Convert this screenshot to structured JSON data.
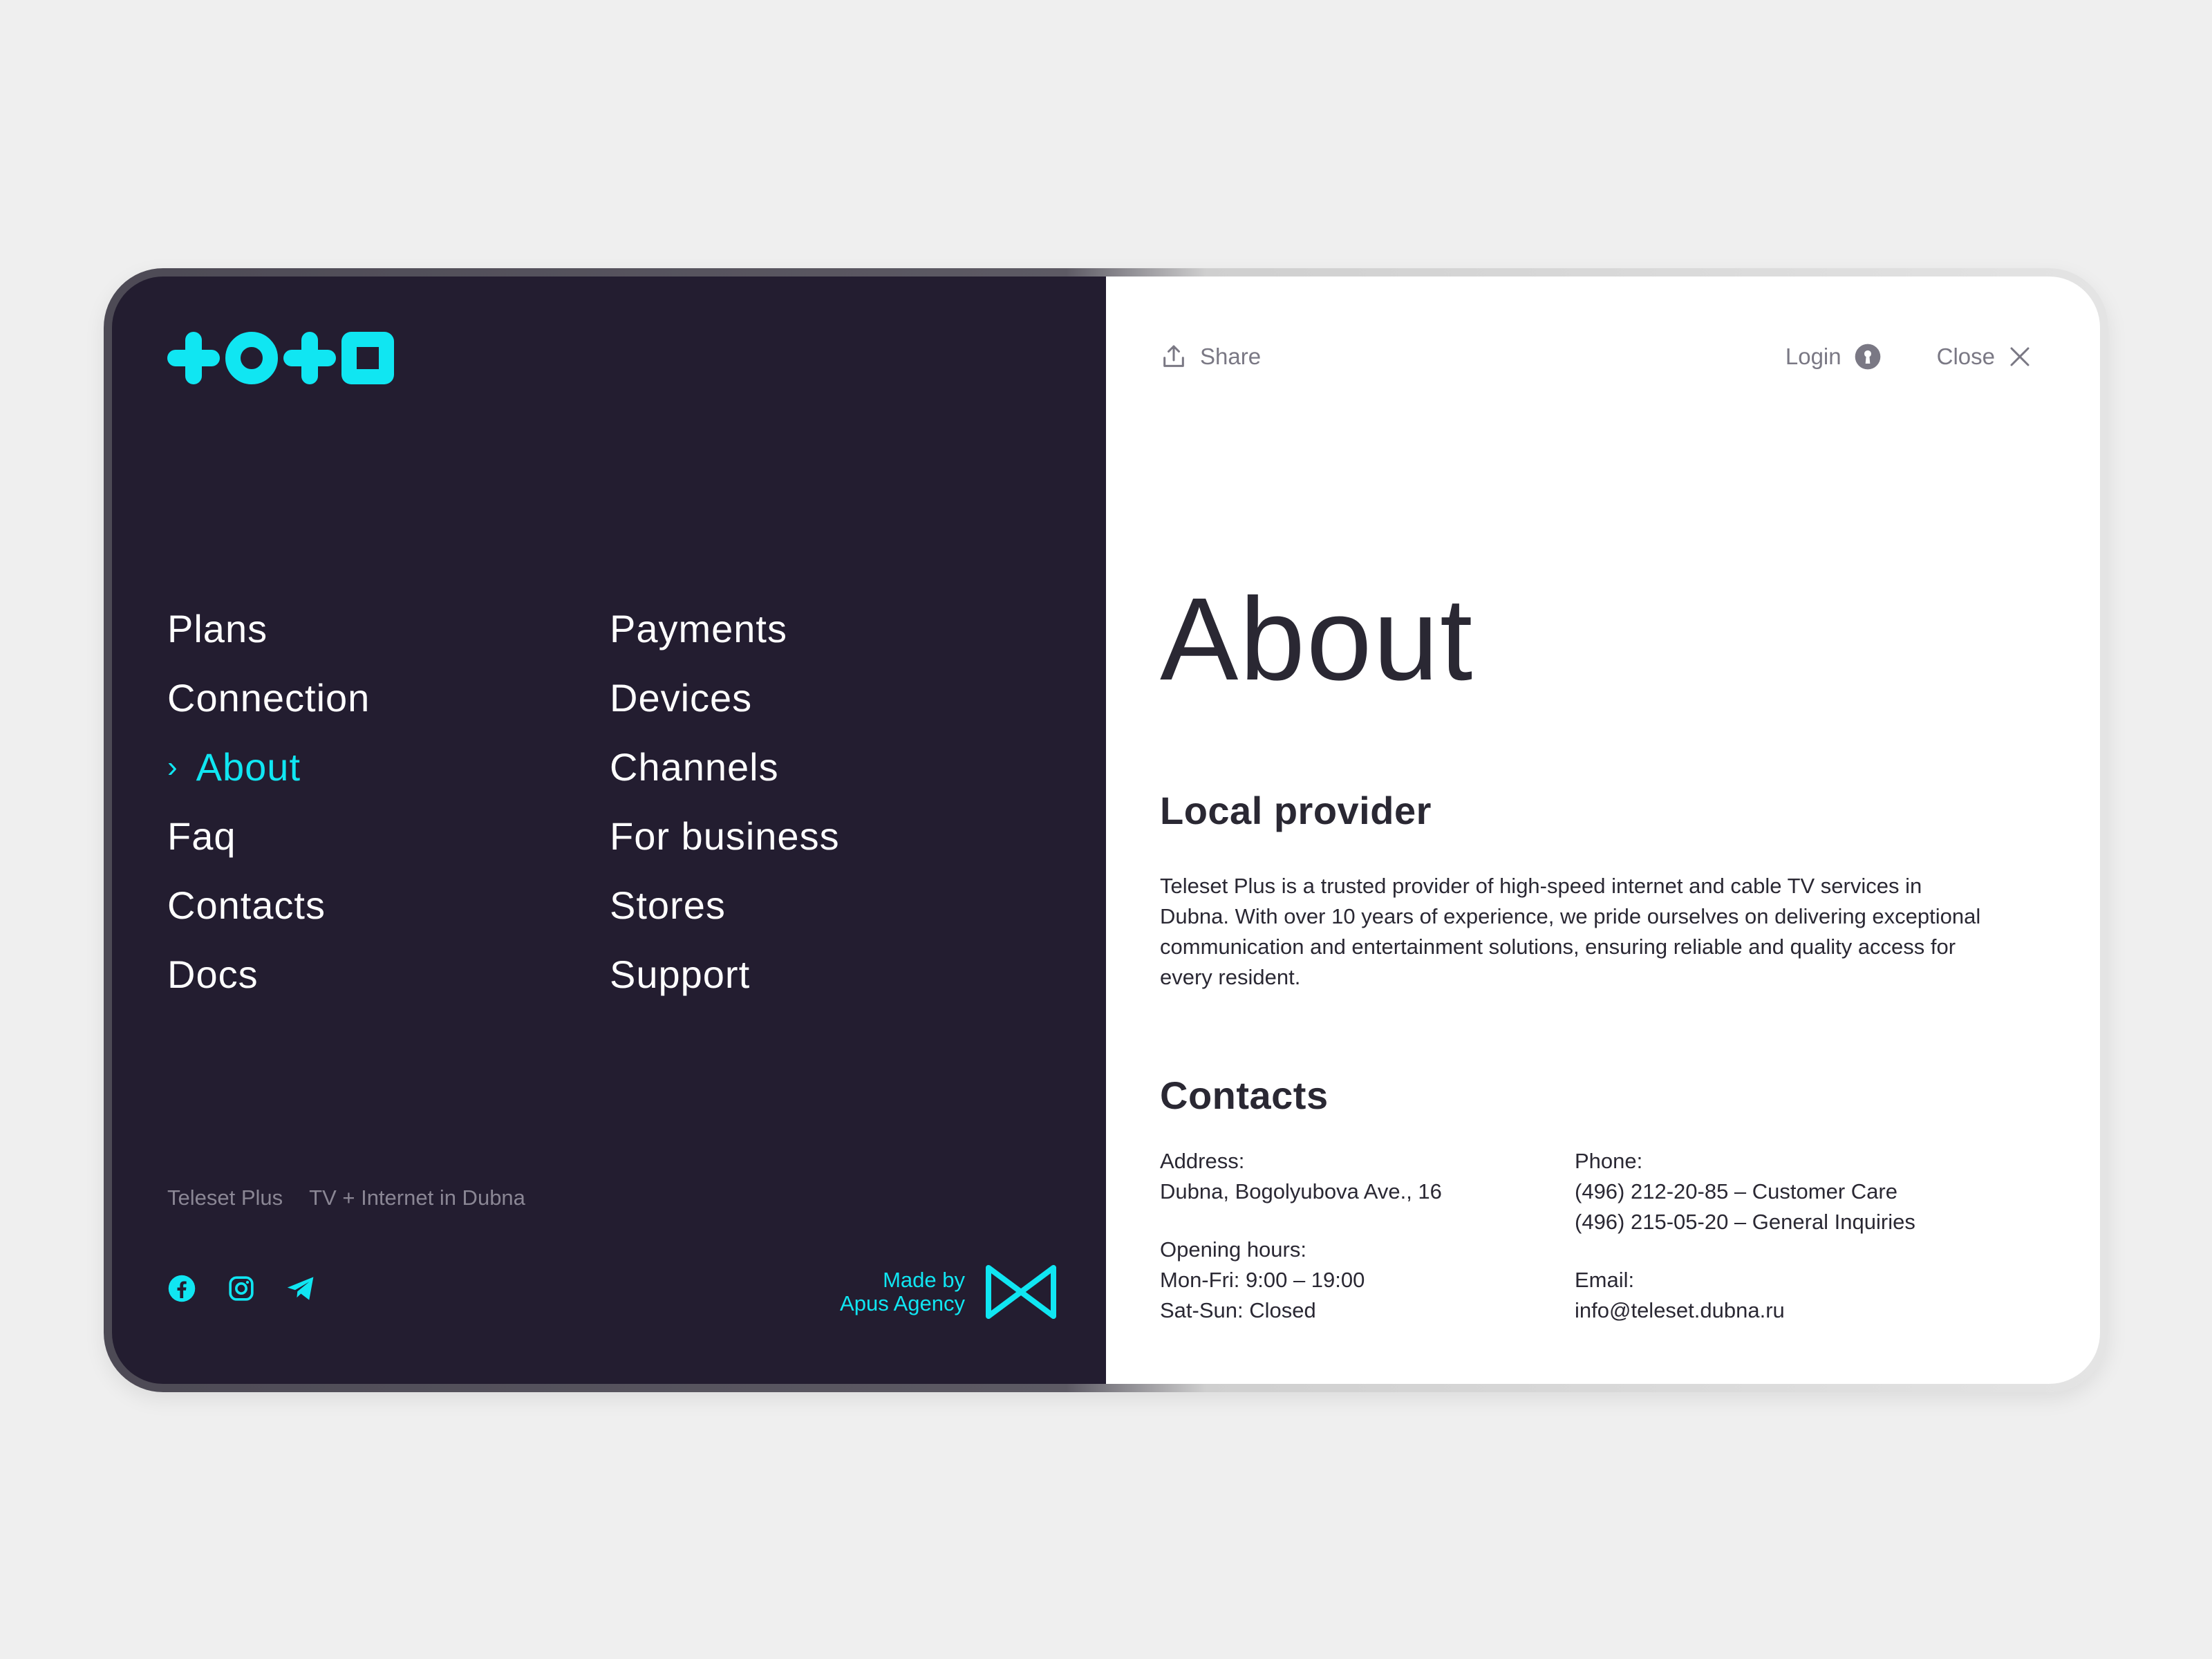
{
  "nav": {
    "col1": [
      "Plans",
      "Connection",
      "About",
      "Faq",
      "Contacts",
      "Docs"
    ],
    "col2": [
      "Payments",
      "Devices",
      "Channels",
      "For business",
      "Stores",
      "Support"
    ],
    "active_chevron": "›"
  },
  "footer": {
    "brand": "Teleset Plus",
    "tagline": "TV + Internet in Dubna",
    "made_by_line1": "Made by",
    "made_by_line2": "Apus Agency",
    "socials": [
      "facebook-icon",
      "instagram-icon",
      "telegram-icon"
    ]
  },
  "topbar": {
    "share": "Share",
    "login": "Login",
    "close": "Close"
  },
  "page": {
    "title": "About",
    "section1_title": "Local provider",
    "section1_text": "Teleset Plus is a trusted provider of high-speed internet and cable TV services in Dubna. With over 10 years of experience, we pride ourselves on delivering exceptional communication and entertainment solutions, ensuring reliable and quality access for every resident.",
    "section2_title": "Contacts",
    "address_label": "Address:",
    "address_value": "Dubna, Bogolyubova Ave., 16",
    "hours_label": "Opening hours:",
    "hours_weekday": "Mon-Fri: 9:00 – 19:00",
    "hours_weekend": "Sat-Sun: Closed",
    "phone_label": "Phone:",
    "phone_1": "(496) 212-20-85 – Customer Care",
    "phone_2": "(496) 215-05-20 – General Inquiries",
    "email_label": "Email:",
    "email_value": "info@teleset.dubna.ru"
  },
  "colors": {
    "accent": "#10e6f2",
    "dark_panel": "#231d30",
    "text_dark": "#2a2833",
    "muted": "#7a7884"
  }
}
